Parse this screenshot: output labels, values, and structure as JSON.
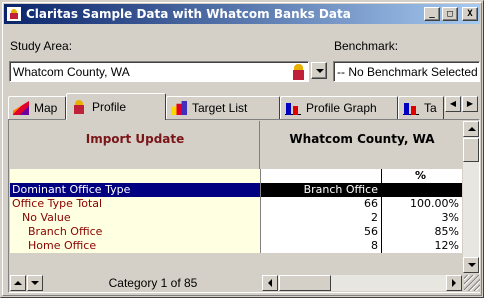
{
  "window": {
    "title": "Claritas Sample Data with Whatcom Banks Data",
    "min_label": "_",
    "max_label": "□",
    "close_label": "X"
  },
  "study_area": {
    "label": "Study Area:",
    "value": "Whatcom County, WA"
  },
  "benchmark": {
    "label": "Benchmark:",
    "value": "-- No Benchmark Selected"
  },
  "tabs": [
    {
      "label": "Map",
      "icon": "map-icon"
    },
    {
      "label": "Profile",
      "icon": "profile-icon",
      "active": true
    },
    {
      "label": "Target List",
      "icon": "target-list-icon"
    },
    {
      "label": "Profile Graph",
      "icon": "profile-graph-icon"
    },
    {
      "label": "Ta",
      "icon": "table-icon"
    }
  ],
  "grid": {
    "left_header": "Import Update",
    "right_header": "Whatcom County, WA",
    "pct_header": "%",
    "rows": [
      {
        "label": "",
        "value": "",
        "pct": "%",
        "kind": "hdr"
      },
      {
        "label": "Dominant Office Type",
        "value": "Branch Office",
        "pct": "",
        "kind": "sel"
      },
      {
        "label": "Office Type Total",
        "value": "66",
        "pct": "100.00%"
      },
      {
        "label": "  No Value",
        "value": "2",
        "pct": "3%"
      },
      {
        "label": "  Branch Office",
        "value": "56",
        "pct": "85%"
      },
      {
        "label": "  Home Office",
        "value": "8",
        "pct": "12%"
      }
    ]
  },
  "footer": {
    "category_text": "Category 1 of 85"
  },
  "colors": {
    "title_start": "#0a246a",
    "title_end": "#a6caf0",
    "label_bg": "#ffffe1",
    "label_text": "#8b0000",
    "selection": "#000080"
  }
}
